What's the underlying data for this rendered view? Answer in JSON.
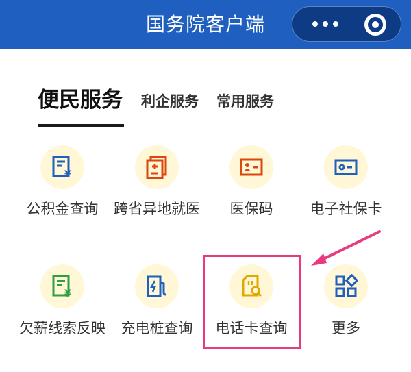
{
  "header": {
    "title": "国务院客户端"
  },
  "tabs": [
    {
      "label": "便民服务",
      "active": true
    },
    {
      "label": "利企服务",
      "active": false
    },
    {
      "label": "常用服务",
      "active": false
    }
  ],
  "services": [
    {
      "label": "公积金查询",
      "icon": "fund-document-icon",
      "color": "#1f5fbf"
    },
    {
      "label": "跨省异地就医",
      "icon": "medical-document-icon",
      "color": "#d9480f"
    },
    {
      "label": "医保码",
      "icon": "id-card-icon",
      "color": "#d9480f"
    },
    {
      "label": "电子社保卡",
      "icon": "social-security-card-icon",
      "color": "#1f5fbf"
    },
    {
      "label": "欠薪线索反映",
      "icon": "wage-report-icon",
      "color": "#2f9e44"
    },
    {
      "label": "充电桩查询",
      "icon": "charging-station-icon",
      "color": "#1f5fbf"
    },
    {
      "label": "电话卡查询",
      "icon": "sim-card-search-icon",
      "color": "#e0a800"
    },
    {
      "label": "更多",
      "icon": "more-grid-icon",
      "color": "#1f5fbf"
    }
  ],
  "colors": {
    "header_bg": "#1f5fbf",
    "highlight": "#e83a80",
    "icon_bg": "#fff7d6"
  }
}
